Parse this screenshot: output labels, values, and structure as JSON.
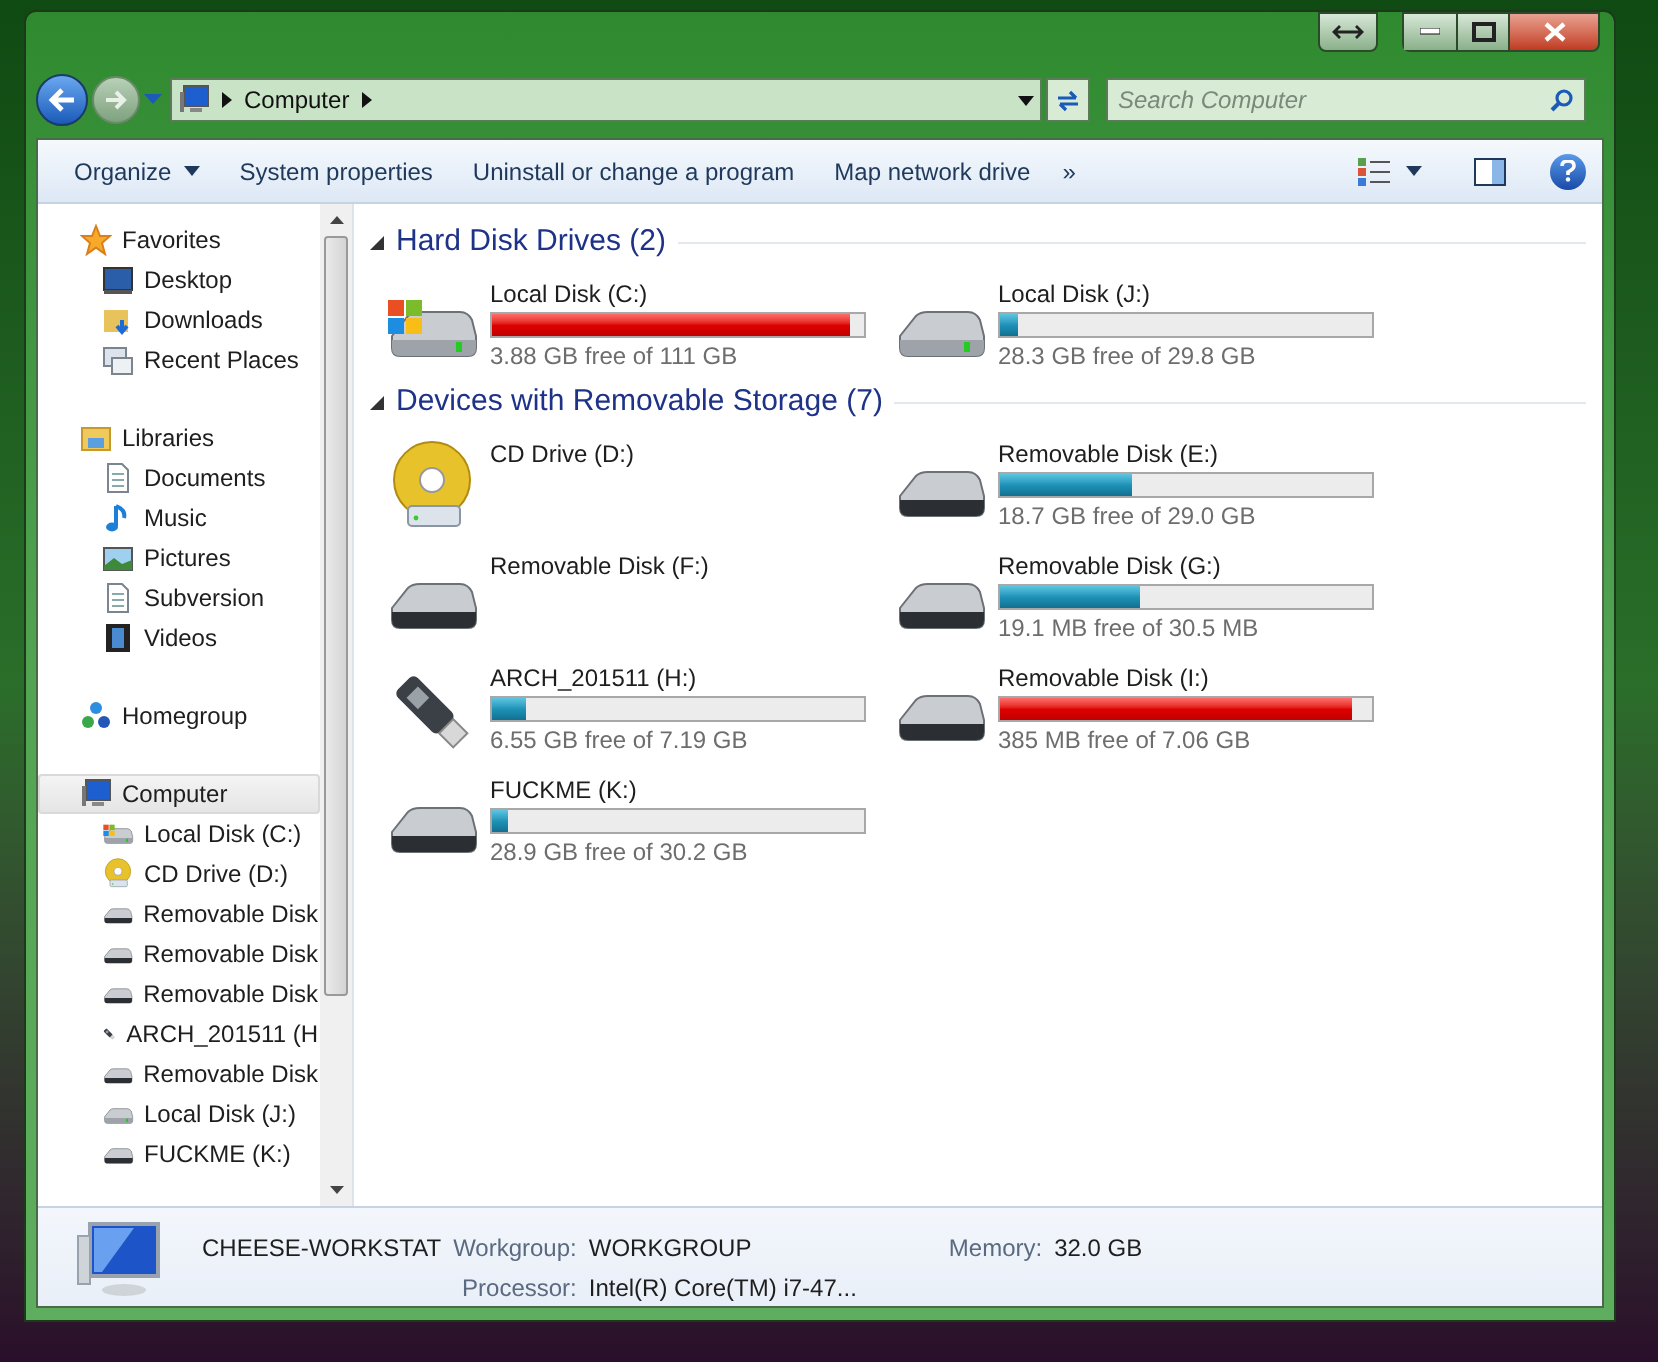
{
  "address": {
    "crumbs": [
      "Computer"
    ]
  },
  "search": {
    "placeholder": "Search Computer"
  },
  "toolbar": {
    "commands": [
      {
        "label": "Organize",
        "kind": "menu"
      },
      {
        "label": "System properties",
        "kind": "button"
      },
      {
        "label": "Uninstall or change a program",
        "kind": "button"
      },
      {
        "label": "Map network drive",
        "kind": "button"
      }
    ],
    "overflow": "»"
  },
  "nav": {
    "groups": [
      {
        "label": "Favorites",
        "kind": "star",
        "selected": false,
        "children": [
          {
            "label": "Desktop",
            "kind": "desktop",
            "selected": false
          },
          {
            "label": "Downloads",
            "kind": "folder",
            "selected": false
          },
          {
            "label": "Recent Places",
            "kind": "recent",
            "selected": false
          }
        ]
      },
      {
        "label": "Libraries",
        "kind": "library",
        "selected": false,
        "children": [
          {
            "label": "Documents",
            "kind": "document",
            "selected": false
          },
          {
            "label": "Music",
            "kind": "music",
            "selected": false
          },
          {
            "label": "Pictures",
            "kind": "picture",
            "selected": false
          },
          {
            "label": "Subversion",
            "kind": "document",
            "selected": false
          },
          {
            "label": "Videos",
            "kind": "video",
            "selected": false
          }
        ]
      },
      {
        "label": "Homegroup",
        "kind": "homegroup",
        "selected": false
      },
      {
        "label": "Computer",
        "kind": "computer",
        "selected": true,
        "children": [
          {
            "label": "Local Disk (C:)",
            "kind": "system",
            "selected": false
          },
          {
            "label": "CD Drive (D:)",
            "kind": "cd",
            "selected": false
          },
          {
            "label": "Removable Disk",
            "kind": "removable",
            "selected": false
          },
          {
            "label": "Removable Disk",
            "kind": "removable",
            "selected": false
          },
          {
            "label": "Removable Disk",
            "kind": "removable",
            "selected": false
          },
          {
            "label": "ARCH_201511 (H",
            "kind": "usb",
            "selected": false
          },
          {
            "label": "Removable Disk",
            "kind": "removable",
            "selected": false
          },
          {
            "label": "Local Disk (J:)",
            "kind": "disk",
            "selected": false
          },
          {
            "label": "FUCKME (K:)",
            "kind": "removable",
            "selected": false
          }
        ]
      }
    ]
  },
  "sections": [
    {
      "title": "Hard Disk Drives (2)",
      "expanded": true,
      "drives": [
        {
          "name": "Local Disk (C:)",
          "kind": "system",
          "level": 0.965,
          "full": true,
          "space": "3.88 GB free of 111 GB"
        },
        {
          "name": "Local Disk (J:)",
          "kind": "disk",
          "level": 0.05,
          "full": false,
          "space": "28.3 GB free of 29.8 GB"
        }
      ]
    },
    {
      "title": "Devices with Removable Storage (7)",
      "expanded": true,
      "drives": [
        {
          "name": "CD Drive (D:)",
          "kind": "cd"
        },
        {
          "name": "Removable Disk (E:)",
          "kind": "removable",
          "level": 0.355,
          "full": false,
          "space": "18.7 GB free of 29.0 GB"
        },
        {
          "name": "Removable Disk (F:)",
          "kind": "removable"
        },
        {
          "name": "Removable Disk (G:)",
          "kind": "removable",
          "level": 0.374,
          "full": false,
          "space": "19.1 MB free of 30.5 MB"
        },
        {
          "name": "ARCH_201511 (H:)",
          "kind": "usb",
          "level": 0.089,
          "full": false,
          "space": "6.55 GB free of 7.19 GB"
        },
        {
          "name": "Removable Disk (I:)",
          "kind": "removable",
          "level": 0.946,
          "full": true,
          "space": "385 MB free of 7.06 GB"
        },
        {
          "name": "FUCKME (K:)",
          "kind": "removable",
          "level": 0.043,
          "full": false,
          "space": "28.9 GB free of 30.2 GB"
        }
      ]
    }
  ],
  "details": {
    "computer_name": "CHEESE-WORKSTAT",
    "fields": [
      {
        "label": "Workgroup:",
        "value": "WORKGROUP"
      },
      {
        "label": "Memory:",
        "value": "32.0 GB"
      },
      {
        "label": "Processor:",
        "value": "Intel(R) Core(TM) i7-47..."
      }
    ]
  }
}
